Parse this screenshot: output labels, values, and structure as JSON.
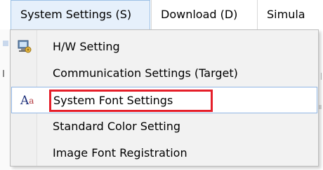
{
  "menubar": {
    "items": [
      {
        "label": "System Settings (S)"
      },
      {
        "label": "Download (D)"
      },
      {
        "label": "Simula"
      }
    ]
  },
  "dropdown": {
    "items": [
      {
        "label": "H/W Setting",
        "icon": "hw-settings-icon"
      },
      {
        "label": "Communication Settings (Target)"
      },
      {
        "label": "System Font Settings",
        "icon": "font-icon",
        "icon_text_a": "A",
        "icon_text_b": "a"
      },
      {
        "label": "Standard Color Setting"
      },
      {
        "label": "Image Font Registration"
      }
    ],
    "highlight_color": "#e51f2a",
    "hover_border_color": "#8fb5e4"
  }
}
